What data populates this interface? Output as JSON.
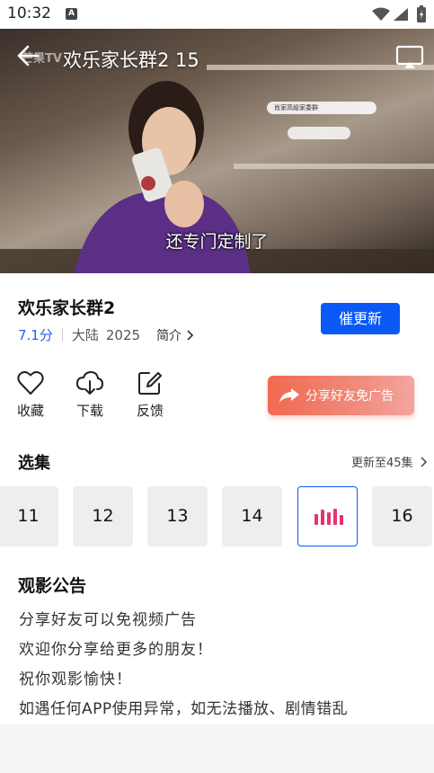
{
  "status_bar": {
    "time": "10:32",
    "notif_icon": "A"
  },
  "player": {
    "title": "欢乐家长群2 15",
    "subtitle": "还专门定制了",
    "logo_text": "芒果TV",
    "phone_ui_text": "肖家高級家委群"
  },
  "show": {
    "title": "欢乐家长群2",
    "score": "7.1分",
    "region": "大陆",
    "year": "2025",
    "intro_label": "简介",
    "update_button": "催更新"
  },
  "actions": {
    "favorite": "收藏",
    "download": "下载",
    "feedback": "反馈",
    "share": "分享好友免广告"
  },
  "episodes": {
    "section_title": "选集",
    "update_info": "更新至45集",
    "items": [
      "11",
      "12",
      "13",
      "14",
      "15",
      "16"
    ],
    "active_index": 4
  },
  "notice": {
    "title": "观影公告",
    "lines": [
      "分享好友可以免视频广告",
      "欢迎你分享给更多的朋友！",
      "祝你观影愉快！",
      "如遇任何APP使用异常，如无法播放、剧情错乱"
    ]
  },
  "colors": {
    "accent": "#0a59f7",
    "score": "#2661e8",
    "share_gradient": "#f16a51",
    "equalizer": "#e8336d"
  }
}
